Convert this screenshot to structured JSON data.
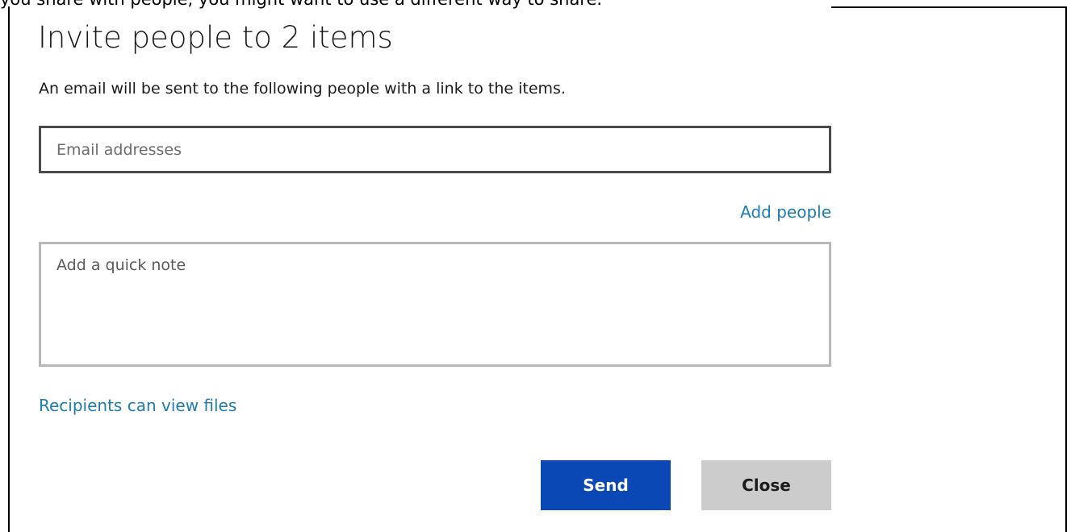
{
  "window": {
    "cut_off_top_text": "you share with people, you might want to use a different way to share.",
    "title": "Invite people to 2 items",
    "subtitle": "An email will be sent to the following people with a link to the items."
  },
  "form": {
    "email": {
      "placeholder": "Email addresses",
      "value": ""
    },
    "add_people_label": "Add people",
    "note": {
      "placeholder": "Add a quick note",
      "value": ""
    },
    "permissions_label": "Recipients can view files"
  },
  "actions": {
    "send_label": "Send",
    "close_label": "Close"
  },
  "colors": {
    "link": "#1e7bb0",
    "primary_button": "#0a49b5",
    "secondary_button": "#cccccc",
    "active_field_border": "#4a4a4a",
    "inactive_field_border": "#b8b8b8"
  }
}
